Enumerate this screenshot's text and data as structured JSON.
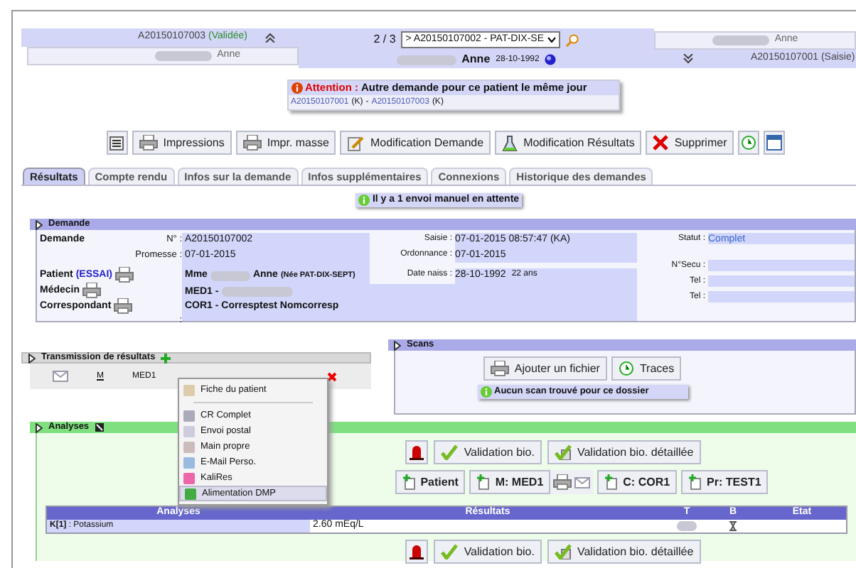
{
  "nav": {
    "prev": {
      "id": "A20150107003",
      "status": "(Validée)"
    },
    "prev_patient": "Anne",
    "position": "2 / 3",
    "select": "> A20150107002 - PAT-DIX-SE",
    "patient_name": "Anne",
    "birth": "28-10-1992",
    "next_patient": "Anne",
    "next": {
      "id": "A20150107001",
      "status": "(Saisie)"
    }
  },
  "alert": {
    "label": "Attention :",
    "message": "Autre demande pour ce patient le même jour",
    "links": [
      {
        "id": "A20150107001",
        "tag": "(K)"
      },
      {
        "id": "A20150107003",
        "tag": "(K)"
      }
    ],
    "separator": "-"
  },
  "toolbar": [
    {
      "kind": "icon"
    },
    {
      "kind": "text",
      "label": "Impressions"
    },
    {
      "kind": "text",
      "label": "Impr. masse"
    },
    {
      "kind": "text",
      "label": "Modification Demande"
    },
    {
      "kind": "text",
      "label": "Modification Résultats"
    },
    {
      "kind": "text",
      "label": "Supprimer"
    },
    {
      "kind": "icon"
    },
    {
      "kind": "icon"
    }
  ],
  "tabs": [
    {
      "label": "Résultats",
      "selected": true
    },
    {
      "label": "Compte rendu",
      "selected": false
    },
    {
      "label": "Infos sur la demande",
      "selected": false
    },
    {
      "label": "Infos supplémentaires",
      "selected": false
    },
    {
      "label": "Connexions",
      "selected": false
    },
    {
      "label": "Historique des demandes",
      "selected": false
    }
  ],
  "notice": "Il y a 1 envoi manuel en attente",
  "demande": {
    "title": "Demande",
    "label": "Demande",
    "number_label": "N° :",
    "number": "A20150107002",
    "promise_label": "Promesse :",
    "promise": "07-01-2015",
    "patient_label": "Patient",
    "patient_tag": "(ESSAI)",
    "patient_title": "Mme",
    "patient_name": "Anne",
    "patient_born": "(Née PAT-DIX-SEPT)",
    "doctor_label": "Médecin",
    "doctor": "MED1 -",
    "correspondent_label": "Correspondant",
    "correspondent": "COR1 - Corresptest Nomcorresp",
    "empty_label": ":",
    "entry_label": "Saisie :",
    "entry": "07-01-2015 08:57:47 (KA)",
    "prescription_label": "Ordonnance :",
    "prescription": "07-01-2015",
    "birth_label": "Date naiss :",
    "birth": "28-10-1992",
    "age": "22 ans",
    "status_label": "Statut :",
    "status": "Complet",
    "ssn_label": "N°Secu :",
    "tel_labels": [
      "Tel :",
      "Tel :"
    ]
  },
  "transmission": {
    "title": "Transmission de résultats",
    "row": {
      "type": "M",
      "recipient": "MED1"
    }
  },
  "menu": [
    {
      "kind": "item",
      "label": "Fiche du patient",
      "selected": false
    },
    {
      "kind": "separator"
    },
    {
      "kind": "item",
      "label": "CR Complet",
      "selected": false
    },
    {
      "kind": "item",
      "label": "Envoi postal",
      "selected": false
    },
    {
      "kind": "item",
      "label": "Main propre",
      "selected": false
    },
    {
      "kind": "item",
      "label": "E-Mail Perso.",
      "selected": false
    },
    {
      "kind": "item",
      "label": "KaliRes",
      "selected": false
    },
    {
      "kind": "item",
      "label": "Alimentation DMP",
      "selected": true
    }
  ],
  "scans": {
    "title": "Scans",
    "buttons": [
      "Ajouter un fichier",
      "Traces"
    ],
    "notice": "Aucun scan trouvé pour ce dossier"
  },
  "analyses": {
    "title": "Analyses",
    "validation_buttons": [
      "Validation bio.",
      "Validation bio. détaillée"
    ],
    "recipients": [
      "Patient",
      "M: MED1",
      "C: COR1",
      "Pr: TEST1"
    ],
    "table": {
      "columns": [
        "Analyses",
        "Résultats",
        "T",
        "B",
        "Etat"
      ],
      "rows": [
        {
          "analysis": "**K[1]** : Potassium",
          "result": "2.60 mEq/L"
        }
      ]
    },
    "bottom_buttons": [
      "Validation bio.",
      "Validation bio. détaillée"
    ]
  }
}
